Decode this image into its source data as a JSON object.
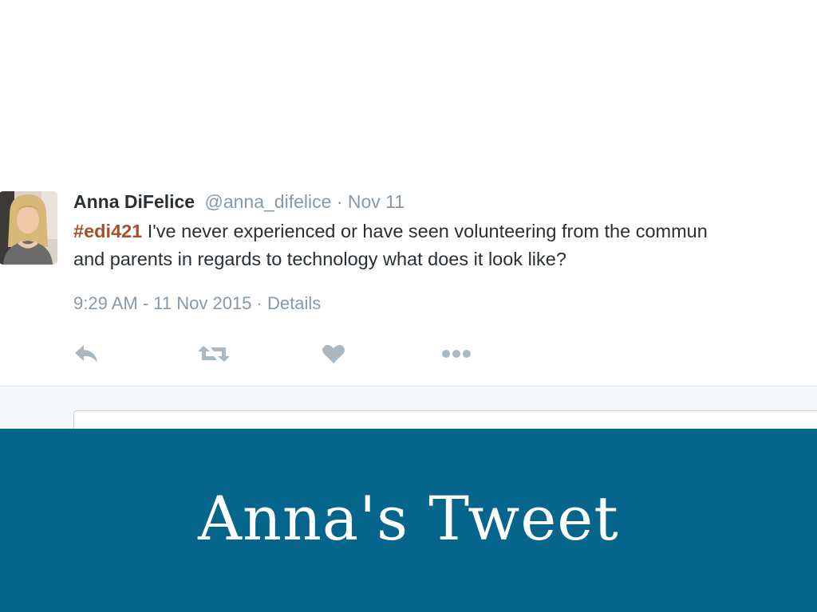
{
  "tweet": {
    "author_name": "Anna DiFelice",
    "handle": "@anna_difelice",
    "separator": "·",
    "date": "Nov 11",
    "hashtag": "#edi421",
    "text_line1": " I've never experienced or have seen volunteering from the commun",
    "text_line2": "and parents in regards to technology what does it look like?",
    "timestamp": "9:29 AM - 11 Nov 2015",
    "meta_separator": "·",
    "details_label": "Details",
    "actions": [
      {
        "name": "reply",
        "icon": "reply-icon"
      },
      {
        "name": "retweet",
        "icon": "retweet-icon"
      },
      {
        "name": "like",
        "icon": "heart-icon"
      },
      {
        "name": "more",
        "icon": "more-icon"
      }
    ]
  },
  "banner": {
    "title": "Anna's Tweet",
    "background": "#05658b"
  },
  "colors": {
    "text": "#292f33",
    "muted": "#8899a6",
    "hashtag": "#a0522d",
    "icon": "#aab8c2"
  }
}
